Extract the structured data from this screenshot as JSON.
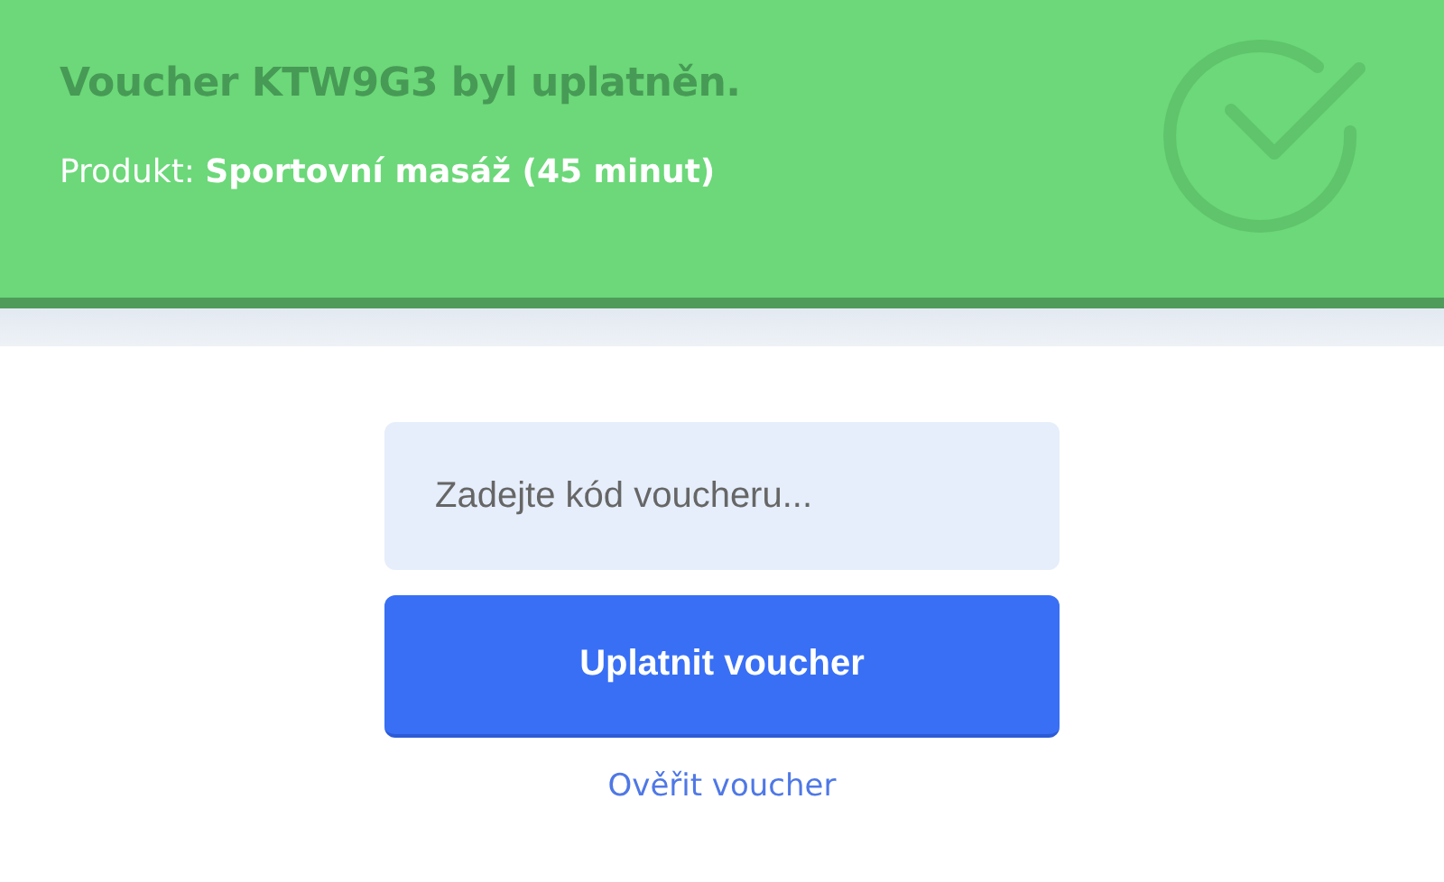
{
  "banner": {
    "title": "Voucher KTW9G3 byl uplatněn.",
    "product": "Produkt: **Sportovní masáž (45 minut)**"
  },
  "form": {
    "code_field": {
      "placeholder": "Zadejte kód voucheru..."
    },
    "submit_button": "Uplatnit voucher",
    "verify_link": "Ověřit voucher"
  }
}
